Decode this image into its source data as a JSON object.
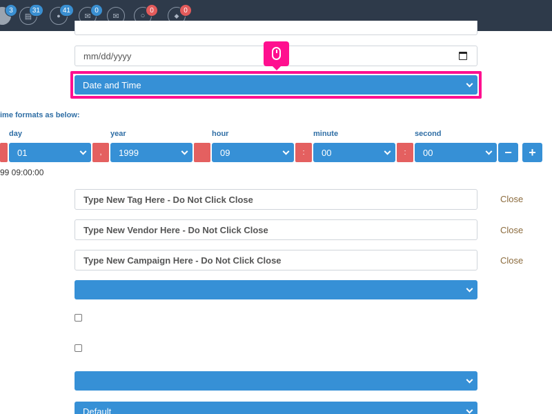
{
  "topbar": {
    "icons": [
      {
        "name": "avatar-icon",
        "badge": "3",
        "badge_color": "blue"
      },
      {
        "name": "document-icon",
        "glyph": "▤",
        "badge": "31",
        "badge_color": "blue"
      },
      {
        "name": "chat-icon",
        "glyph": "●",
        "badge": "41",
        "badge_color": "blue"
      },
      {
        "name": "mail-icon",
        "glyph": "✉",
        "badge": "0",
        "badge_color": "blue"
      },
      {
        "name": "open-mail-icon",
        "glyph": "✉",
        "badge": "",
        "badge_color": ""
      },
      {
        "name": "comment-icon",
        "glyph": "○",
        "badge": "0",
        "badge_color": "red"
      },
      {
        "name": "ticket-icon",
        "glyph": "◆",
        "badge": "0",
        "badge_color": "red"
      }
    ]
  },
  "date_input": {
    "placeholder": "mm/dd/yyyy"
  },
  "type_select": {
    "value": "Date and Time"
  },
  "formats_label": "ime formats as below:",
  "columns": {
    "day": {
      "label": "day",
      "value": "01"
    },
    "year": {
      "label": "year",
      "value": "1999"
    },
    "hour": {
      "label": "hour",
      "value": "09"
    },
    "minute": {
      "label": "minute",
      "value": "00"
    },
    "second": {
      "label": "second",
      "value": "00"
    }
  },
  "separators": {
    "comma": ",",
    "colon1": ":",
    "colon2": ":"
  },
  "buttons": {
    "minus": "−",
    "plus": "+"
  },
  "preview": "99 09:00:00",
  "tag_input": {
    "placeholder": "Type New Tag Here - Do Not Click Close"
  },
  "vendor_input": {
    "placeholder": "Type New Vendor Here - Do Not Click Close"
  },
  "campaign_input": {
    "placeholder": "Type New Campaign Here - Do Not Click Close"
  },
  "close_label": "Close",
  "bottom_select": {
    "value": "Default"
  },
  "colors": {
    "accent": "#3690d6",
    "highlight": "#ff0f8f",
    "danger": "#e46060",
    "topbar": "#2e3a4a"
  }
}
